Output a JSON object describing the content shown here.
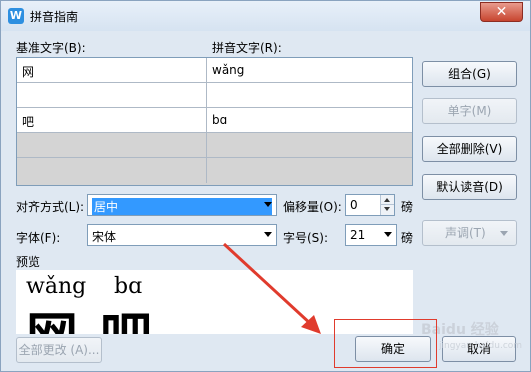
{
  "window": {
    "title": "拼音指南",
    "app_icon_letter": "W",
    "close_label": "✕"
  },
  "table": {
    "headers": [
      "基准文字(B):",
      "拼音文字(R):"
    ],
    "rows": [
      {
        "base": "网",
        "pinyin": "wǎng"
      },
      {
        "base": "",
        "pinyin": ""
      },
      {
        "base": "吧",
        "pinyin": "bɑ"
      },
      {
        "base": "",
        "pinyin": ""
      },
      {
        "base": "",
        "pinyin": ""
      }
    ]
  },
  "side_buttons": {
    "combine": "组合(G)",
    "single": "单字(M)",
    "delete_all": "全部删除(V)",
    "default_reading": "默认读音(D)",
    "tone": "声调(T)"
  },
  "options": {
    "alignment_label": "对齐方式(L):",
    "alignment_value": "居中",
    "offset_label": "偏移量(O):",
    "offset_value": "0",
    "offset_unit": "磅",
    "font_label": "字体(F):",
    "font_value": "宋体",
    "size_label": "字号(S):",
    "size_value": "21",
    "size_unit": "磅"
  },
  "preview": {
    "label": "预览",
    "items": [
      {
        "pinyin": "wǎng",
        "hanzi": "网"
      },
      {
        "pinyin": "bɑ",
        "hanzi": "吧"
      }
    ]
  },
  "footer": {
    "change_all": "全部更改 (A)...",
    "ok": "确定",
    "cancel": "取消"
  },
  "watermark": {
    "text": "Baidu 经验",
    "sub": "jingyan.baidu.com"
  },
  "annotation": {
    "arrow_color": "#e03b2d",
    "box_color": "#e03b2d"
  }
}
